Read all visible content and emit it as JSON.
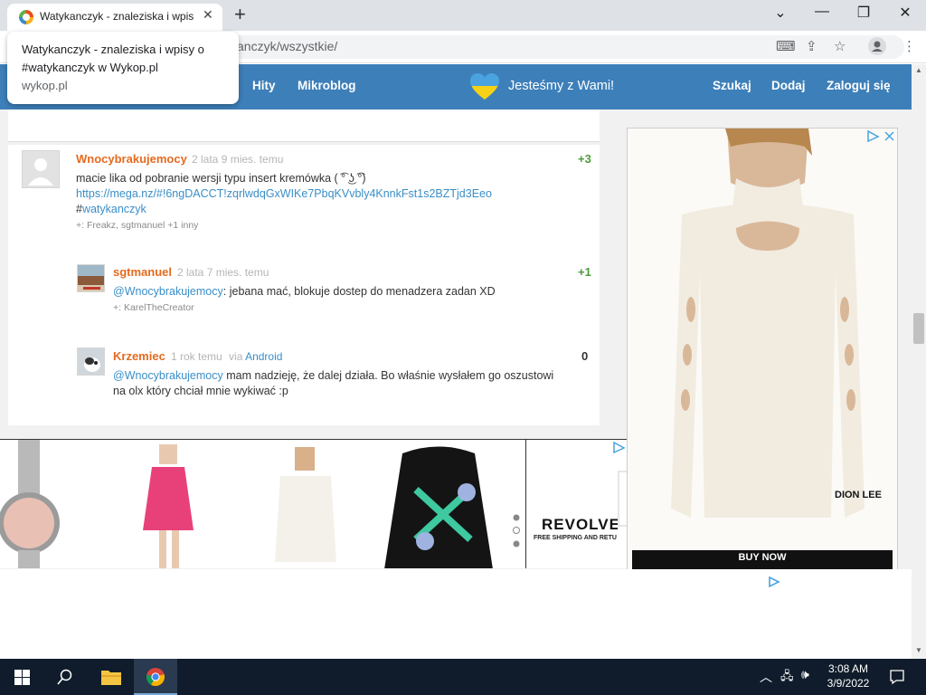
{
  "browser": {
    "tab_title": "Watykanczyk - znaleziska i wpisy",
    "url": "anczyk/wszystkie/",
    "tooltip": {
      "title": "Watykanczyk - znaleziska i wpisy o #watykanczyk w Wykop.pl",
      "domain": "wykop.pl"
    }
  },
  "nav": {
    "hits": "Hity",
    "microblog": "Mikroblog",
    "banner": "Jesteśmy z Wami!",
    "search": "Szukaj",
    "add": "Dodaj",
    "login": "Zaloguj się"
  },
  "entries": [
    {
      "author": "Wnocybrakujemocy",
      "time": "2 lata 9 mies. temu",
      "votes": "+3",
      "text_line1": "macie lika od pobranie wersji typu insert kremówka ( ͡° ͜ʖ ͡°)",
      "link": "https://mega.nz/#!6ngDACCT!zqrlwdqGxWIKe7PbqKVvbly4KnnkFst1s2BZTjd3Eeo",
      "tag_hash": "#",
      "tag": "watykanczyk",
      "plus_list": "+: Freakz, sgtmanuel +1 inny"
    },
    {
      "author": "sgtmanuel",
      "time": "2 lata 7 mies. temu",
      "votes": "+1",
      "mention": "@Wnocybrakujemocy",
      "text": ": jebana mać, blokuje dostep do menadzera zadan XD",
      "plus_list": "+: KarelTheCreator"
    },
    {
      "author": "Krzemiec",
      "time": "1 rok temu",
      "via_label": "via",
      "via": "Android",
      "votes": "0",
      "mention": "@Wnocybrakujemocy",
      "text": " mam nadzieję, że dalej działa. Bo właśnie wysłałem go oszustowi",
      "text_line2": "na olx który chciał mnie wykiwać :p"
    }
  ],
  "ads": {
    "brand": "REVOLVE",
    "shipping": "FREE SHIPPING AND RETURNS",
    "right_brand": "DION LEE",
    "cta": "BUY NOW"
  },
  "taskbar": {
    "time": "3:08 AM",
    "date": "3/9/2022"
  },
  "colors": {
    "header": "#3d7fb9",
    "author": "#e66a1f",
    "link": "#3a8ec7",
    "vote_positive": "#4a9c3a"
  }
}
